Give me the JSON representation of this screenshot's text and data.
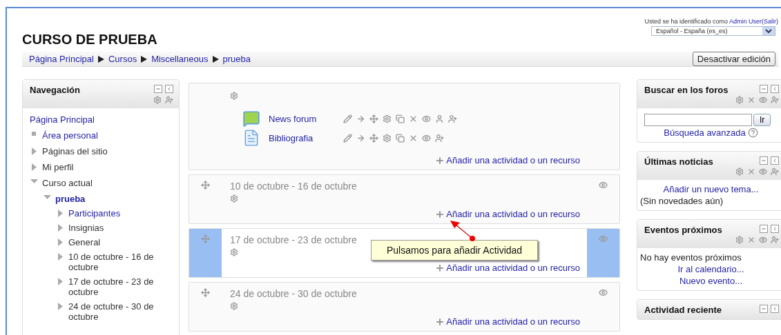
{
  "header": {
    "title": "CURSO DE PRUEBA",
    "login_text": "Usted se ha identificado como",
    "user_link": "Admin User",
    "logout_link": "(Salir)",
    "language": "Español - España (es_es)"
  },
  "breadcrumb": [
    {
      "label": "Página Principal"
    },
    {
      "label": "Cursos"
    },
    {
      "label": "Miscellaneous"
    },
    {
      "label": "prueba"
    }
  ],
  "edit_button": "Desactivar edición",
  "navigation": {
    "title": "Navegación",
    "items": [
      {
        "label": "Página Principal",
        "kind": "root",
        "link": true,
        "current": false
      },
      {
        "label": "Área personal",
        "kind": "leaf",
        "link": true,
        "current": false
      },
      {
        "label": "Páginas del sitio",
        "kind": "branch",
        "link": false,
        "current": false,
        "expanded": false
      },
      {
        "label": "Mi perfil",
        "kind": "branch",
        "link": false,
        "current": false,
        "expanded": false
      },
      {
        "label": "Curso actual",
        "kind": "branch",
        "link": false,
        "current": false,
        "expanded": true,
        "children": [
          {
            "label": "prueba",
            "kind": "branch",
            "link": true,
            "current": true,
            "expanded": true,
            "children": [
              {
                "label": "Participantes",
                "kind": "branch",
                "link": true,
                "current": false,
                "expanded": false
              },
              {
                "label": "Insignias",
                "kind": "branch",
                "link": false,
                "current": false,
                "expanded": false
              },
              {
                "label": "General",
                "kind": "branch",
                "link": false,
                "current": false,
                "expanded": false
              },
              {
                "label": "10 de octubre - 16 de octubre",
                "kind": "branch",
                "link": false,
                "current": false,
                "expanded": false
              },
              {
                "label": "17 de octubre - 23 de octubre",
                "kind": "branch",
                "link": false,
                "current": false,
                "expanded": false
              },
              {
                "label": "24 de octubre - 30 de octubre",
                "kind": "branch",
                "link": false,
                "current": false,
                "expanded": false
              }
            ]
          }
        ]
      }
    ]
  },
  "sections": [
    {
      "highlighted": false,
      "activities": [
        {
          "kind": "forum",
          "name": "News forum"
        },
        {
          "kind": "resource",
          "name": "Bibliografia"
        }
      ],
      "add_link": "Añadir una actividad o un recurso"
    },
    {
      "title": "10 de octubre - 16 de octubre",
      "highlighted": false,
      "add_link": "Añadir una actividad o un recurso"
    },
    {
      "title": "17 de octubre - 23 de octubre",
      "highlighted": true,
      "add_link": "Añadir una actividad o un recurso",
      "callout": "Pulsamos para añadir Actividad"
    },
    {
      "title": "24 de octubre - 30 de octubre",
      "highlighted": false,
      "add_link": "Añadir una actividad o un recurso"
    }
  ],
  "blocks": [
    {
      "title": "Buscar en los foros",
      "content": [
        {
          "kind": "search",
          "button": "Ir"
        },
        {
          "kind": "help_link",
          "text": "Búsqueda avanzada"
        }
      ]
    },
    {
      "title": "Últimas noticias",
      "content": [
        {
          "kind": "link",
          "text": "Añadir un nuevo tema..."
        },
        {
          "kind": "text",
          "text": "(Sin novedades aún)"
        }
      ]
    },
    {
      "title": "Eventos próximos",
      "content": [
        {
          "kind": "text",
          "text": "No hay eventos próximos"
        },
        {
          "kind": "link",
          "text": "Ir al calendario..."
        },
        {
          "kind": "link",
          "text": "Nuevo evento..."
        }
      ]
    },
    {
      "title": "Actividad reciente"
    }
  ]
}
